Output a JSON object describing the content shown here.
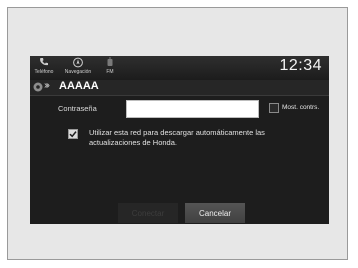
{
  "status_bar": {
    "nav": [
      {
        "label": "Teléfono",
        "icon": "phone-icon"
      },
      {
        "label": "Navegación",
        "icon": "compass-icon"
      },
      {
        "label": "FM",
        "icon": "radio-icon"
      }
    ],
    "clock": "12:34"
  },
  "header": {
    "network_name": "AAAAA",
    "icon": "wifi-settings-icon"
  },
  "form": {
    "password_label": "Contraseña",
    "password_value": "",
    "show_password_label": "Most. contrs.",
    "show_password_checked": false,
    "auto_update_label": "Utilizar esta red para descargar automáticamente las actualizaciones de Honda.",
    "auto_update_checked": true
  },
  "buttons": {
    "connect_label": "Conectar",
    "cancel_label": "Cancelar"
  },
  "colors": {
    "screen_bg": "#1d1d1d",
    "text": "#e2e2e2",
    "button_active": "#4a4a4a",
    "button_disabled_text": "#3d3d3d"
  }
}
